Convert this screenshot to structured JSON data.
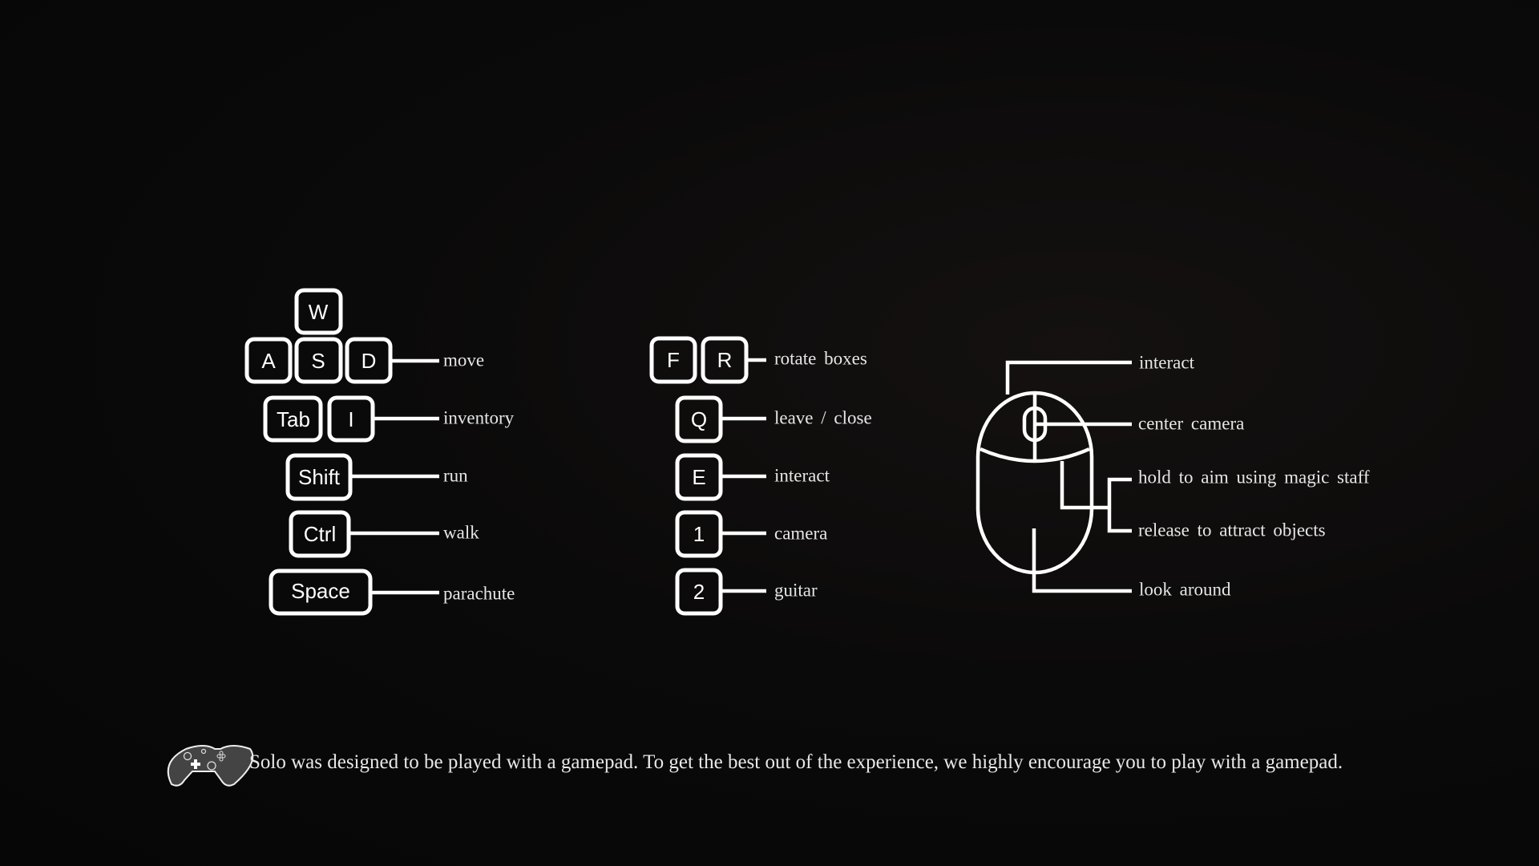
{
  "keyboard_left": [
    {
      "keys": [
        "W",
        "A",
        "S",
        "D"
      ],
      "action": "move"
    },
    {
      "keys": [
        "Tab",
        "I"
      ],
      "action": "inventory"
    },
    {
      "keys": [
        "Shift"
      ],
      "action": "run"
    },
    {
      "keys": [
        "Ctrl"
      ],
      "action": "walk"
    },
    {
      "keys": [
        "Space"
      ],
      "action": "parachute"
    }
  ],
  "keyboard_middle": [
    {
      "keys": [
        "F",
        "R"
      ],
      "action": "rotate boxes"
    },
    {
      "keys": [
        "Q"
      ],
      "action": "leave / close"
    },
    {
      "keys": [
        "E"
      ],
      "action": "interact"
    },
    {
      "keys": [
        "1"
      ],
      "action": "camera"
    },
    {
      "keys": [
        "2"
      ],
      "action": "guitar"
    }
  ],
  "mouse": {
    "left_button": "interact",
    "wheel": "center camera",
    "right_hold": "hold to aim using magic staff",
    "right_release": "release to attract objects",
    "move": "look around"
  },
  "gamepad_icon": "gamepad-icon",
  "note": "Solo was designed to be played with a gamepad. To get the best out of the experience, we highly encourage you to play with a gamepad."
}
